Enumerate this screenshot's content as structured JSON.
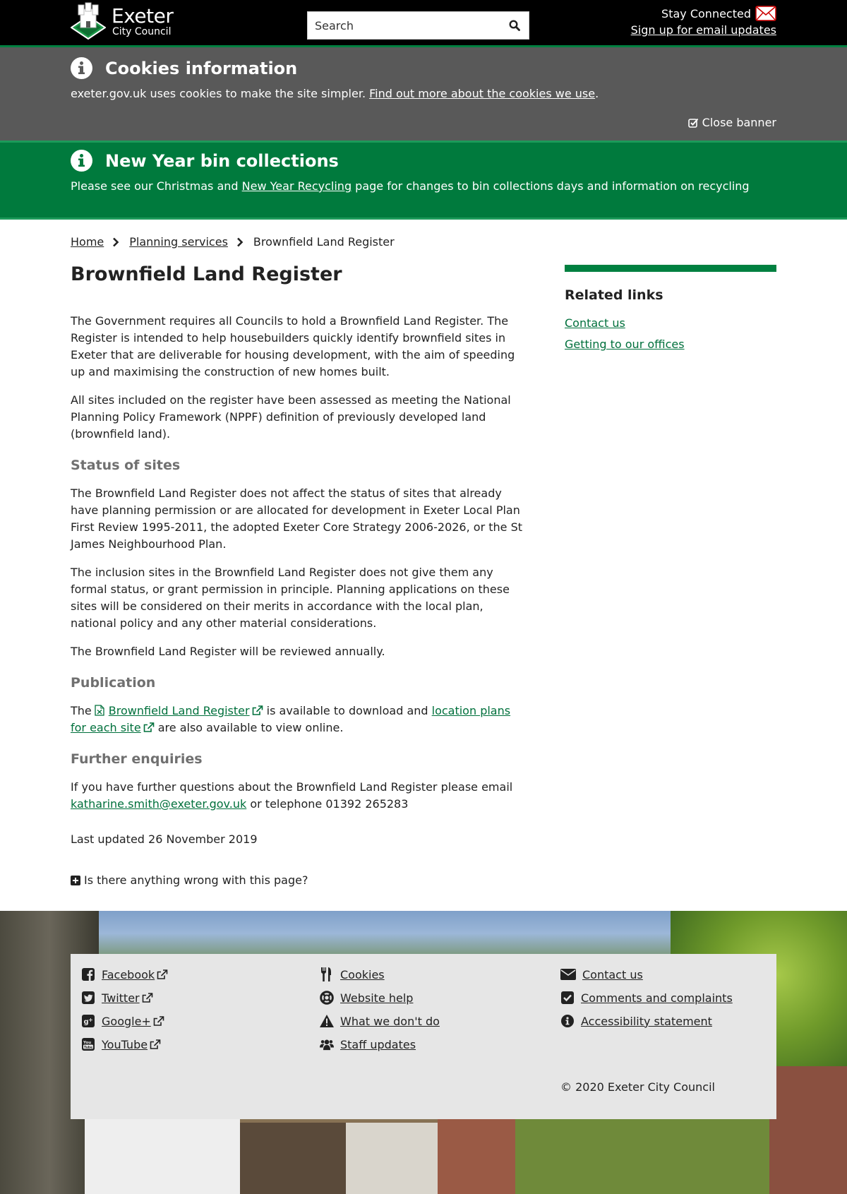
{
  "header": {
    "logo_line1": "Exeter",
    "logo_line2": "City Council",
    "search_placeholder": "Search",
    "stay_connected": "Stay Connected",
    "email_updates_link": "Sign up for email updates"
  },
  "cookie_banner": {
    "title": "Cookies information",
    "text_before": "exeter.gov.uk uses cookies to make the site simpler. ",
    "link": "Find out more about the cookies we use",
    "text_after": ".",
    "close": "Close banner"
  },
  "bin_banner": {
    "title": "New Year bin collections",
    "text_before": "Please see our Christmas and ",
    "link": "New Year Recycling",
    "text_after": " page for changes to bin collections days and information on recycling"
  },
  "breadcrumb": {
    "home": "Home",
    "planning": "Planning services",
    "current": "Brownfield Land Register"
  },
  "main": {
    "title": "Brownfield Land Register",
    "intro_p1": "The Government requires all Councils to hold a Brownfield Land Register. The Register is intended to help housebuilders quickly identify brownfield sites in Exeter that are deliverable for housing development, with the aim of speeding up and maximising the construction of new homes built.",
    "intro_p2": "All sites included on the register have been assessed as meeting the National Planning Policy Framework (NPPF) definition of previously developed land (brownfield land).",
    "status_heading": "Status of sites",
    "status_p1": "The Brownfield Land Register does not affect the status of sites that already have planning permission or are allocated for development in Exeter Local Plan First Review 1995-2011, the adopted Exeter Core Strategy 2006-2026, or the St James Neighbourhood Plan.",
    "status_p2": "The inclusion sites in the Brownfield Land Register does not give them any formal status, or grant permission in principle. Planning applications on these sites will be considered on their merits in accordance with the local plan, national policy and any other material considerations.",
    "status_p3": "The Brownfield Land Register will be reviewed annually.",
    "publication_heading": "Publication",
    "pub_the": "The",
    "pub_link1": "Brownfield Land Register",
    "pub_mid": " is available to download and ",
    "pub_link2": "location plans for each site",
    "pub_end": " are also available to view online.",
    "enquiries_heading": "Further enquiries",
    "enq_before": "If you have further questions about the Brownfield Land Register please email ",
    "enq_email": "katharine.smith@exeter.gov.uk",
    "enq_after": " or telephone 01392 265283",
    "last_updated": "Last updated 26 November 2019",
    "wrong_page": "Is there anything wrong with this page?"
  },
  "sidebar": {
    "heading": "Related links",
    "links": [
      "Contact us",
      "Getting to our offices"
    ]
  },
  "footer": {
    "col1": [
      "Facebook",
      "Twitter",
      "Google+",
      "YouTube"
    ],
    "col2": [
      "Cookies",
      "Website help",
      "What we don't do",
      "Staff updates"
    ],
    "col3": [
      "Contact us",
      "Comments and complaints",
      "Accessibility statement"
    ],
    "copyright": "© 2020 Exeter City Council"
  },
  "colors": {
    "brand_green": "#008040",
    "link_green": "#00703c",
    "cookie_grey": "#595959",
    "header_black": "#000000"
  }
}
